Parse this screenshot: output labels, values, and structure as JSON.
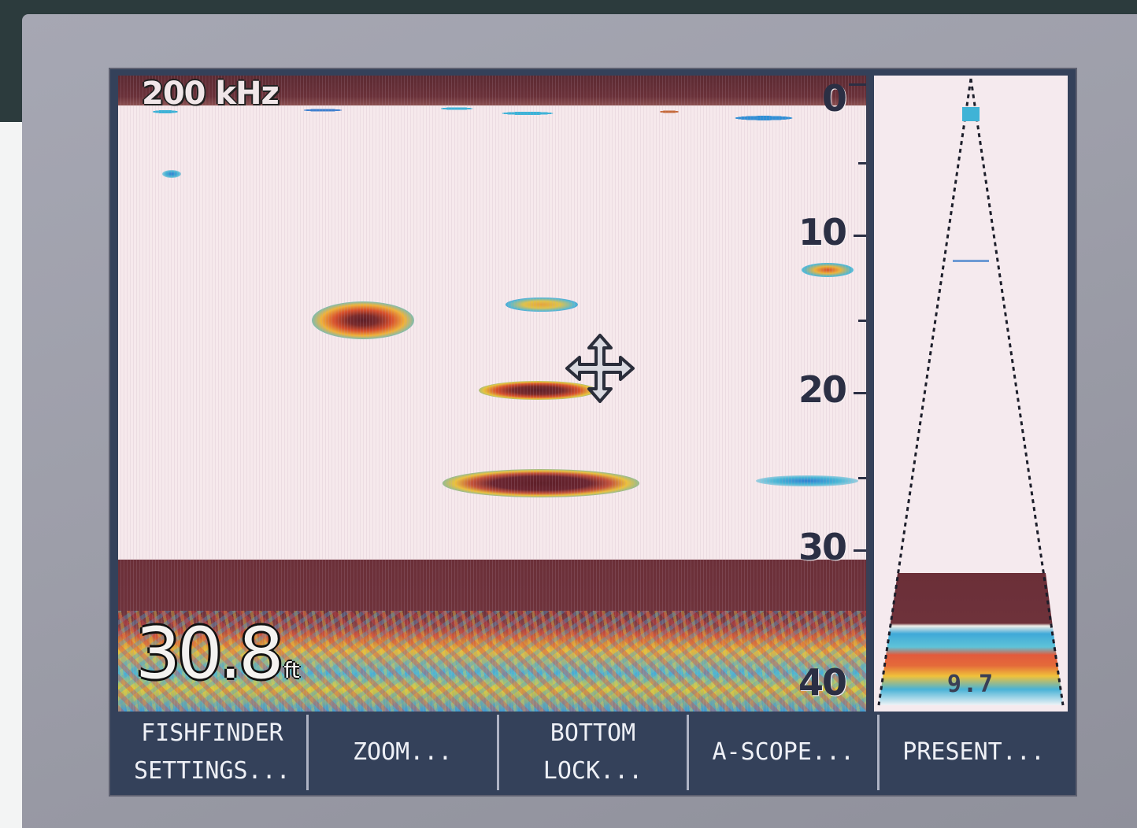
{
  "sonar": {
    "frequency_label": "200 kHz",
    "depth_value": "30.8",
    "depth_unit": "ft",
    "scale_ticks": [
      "0",
      "10",
      "20",
      "30",
      "40"
    ],
    "ascope_value": "9.7"
  },
  "softkeys": [
    {
      "label": "FISHFINDER\nSETTINGS..."
    },
    {
      "label": "ZOOM..."
    },
    {
      "label": "BOTTOM\nLOCK..."
    },
    {
      "label": "A-SCOPE..."
    },
    {
      "label": "PRESENT..."
    }
  ],
  "colors": {
    "bezel": "#9d9ea9",
    "screen_background": "#f6e9ec",
    "softkey_bar": "#34415a",
    "surface_band": "#6a3139",
    "seabed_band": "#6e323b"
  },
  "icons": {
    "cursor": "move-cursor-icon"
  }
}
